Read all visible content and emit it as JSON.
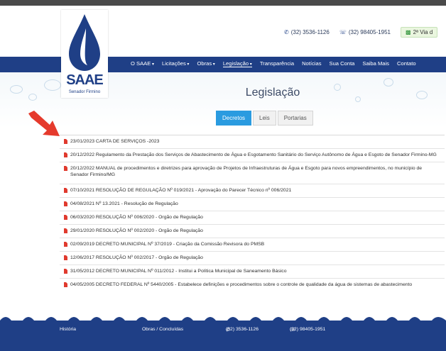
{
  "header": {
    "phone": "(32) 3536-1126",
    "whatsapp": "(32) 98405-1951",
    "second_copy": "2ª Via d"
  },
  "logo": {
    "brand": "SAAE",
    "subtitle": "Senador Firmino"
  },
  "nav": {
    "items": [
      {
        "label": "O SAAE"
      },
      {
        "label": "Licitações"
      },
      {
        "label": "Obras"
      },
      {
        "label": "Legislação"
      },
      {
        "label": "Transparência"
      },
      {
        "label": "Notícias"
      },
      {
        "label": "Sua Conta"
      },
      {
        "label": "Saiba Mais"
      },
      {
        "label": "Contato"
      }
    ]
  },
  "page": {
    "title": "Legislação",
    "tabs": [
      {
        "label": "Decretos"
      },
      {
        "label": "Leis"
      },
      {
        "label": "Portarias"
      }
    ]
  },
  "documents": [
    {
      "text": "23/01/2023 CARTA DE SERVIÇOS -2023"
    },
    {
      "text": "20/12/2022 Regulamento da Prestação dos Serviços de Abastecimento de Água e Esgotamento Sanitário do Serviço Autônomo de Água e Esgoto de Senador Firmino-MG"
    },
    {
      "text": "20/12/2022 MANUAL de procedimentos e diretrizes para aprovação de Projetos de Infraestruturas de Água e Esgoto para novos empreendimentos, no município de Senador Firmino/MG"
    },
    {
      "text": "07/10/2021 RESOLUÇÃO DE REGULAÇÃO Nº 019/2021 - Aprovação do Parecer Técnico nº 006/2021"
    },
    {
      "text": "04/08/2021 Nº 13.2021 - Resolução de Regulação"
    },
    {
      "text": "06/03/2020 RESOLUÇÃO Nº 006/2020 - Orgão de Regulação"
    },
    {
      "text": "29/01/2020 RESOLUÇÃO Nº 002/2020 - Orgão de Regulação"
    },
    {
      "text": "02/09/2019 DECRETO MUNICIPAL Nº 37/2019 - Criação da Comissão Revisora do PMSB"
    },
    {
      "text": "12/06/2017 RESOLUÇÃO Nº 002/2017 - Orgão de Regulação"
    },
    {
      "text": "31/05/2012 DECRETO MUNICIPAL Nº 011/2012 - Institui a Política Municipal de Saneamento Básico"
    },
    {
      "text": "04/05/2005 DECRETO FEDERAL Nº 5440/2005 - Estabelece definições e procedimentos sobre o controle de qualidade da água de sistemas de abastecimento"
    }
  ],
  "footer": {
    "history": "História",
    "works": "Obras / Concluídas",
    "phone": "(32) 3536-1126",
    "whatsapp": "(32) 98405-1951"
  },
  "colors": {
    "primary": "#1f3f86",
    "tab_active": "#2a9be0",
    "pdf_icon": "#e03a2e",
    "arrow": "#e53a2c"
  }
}
